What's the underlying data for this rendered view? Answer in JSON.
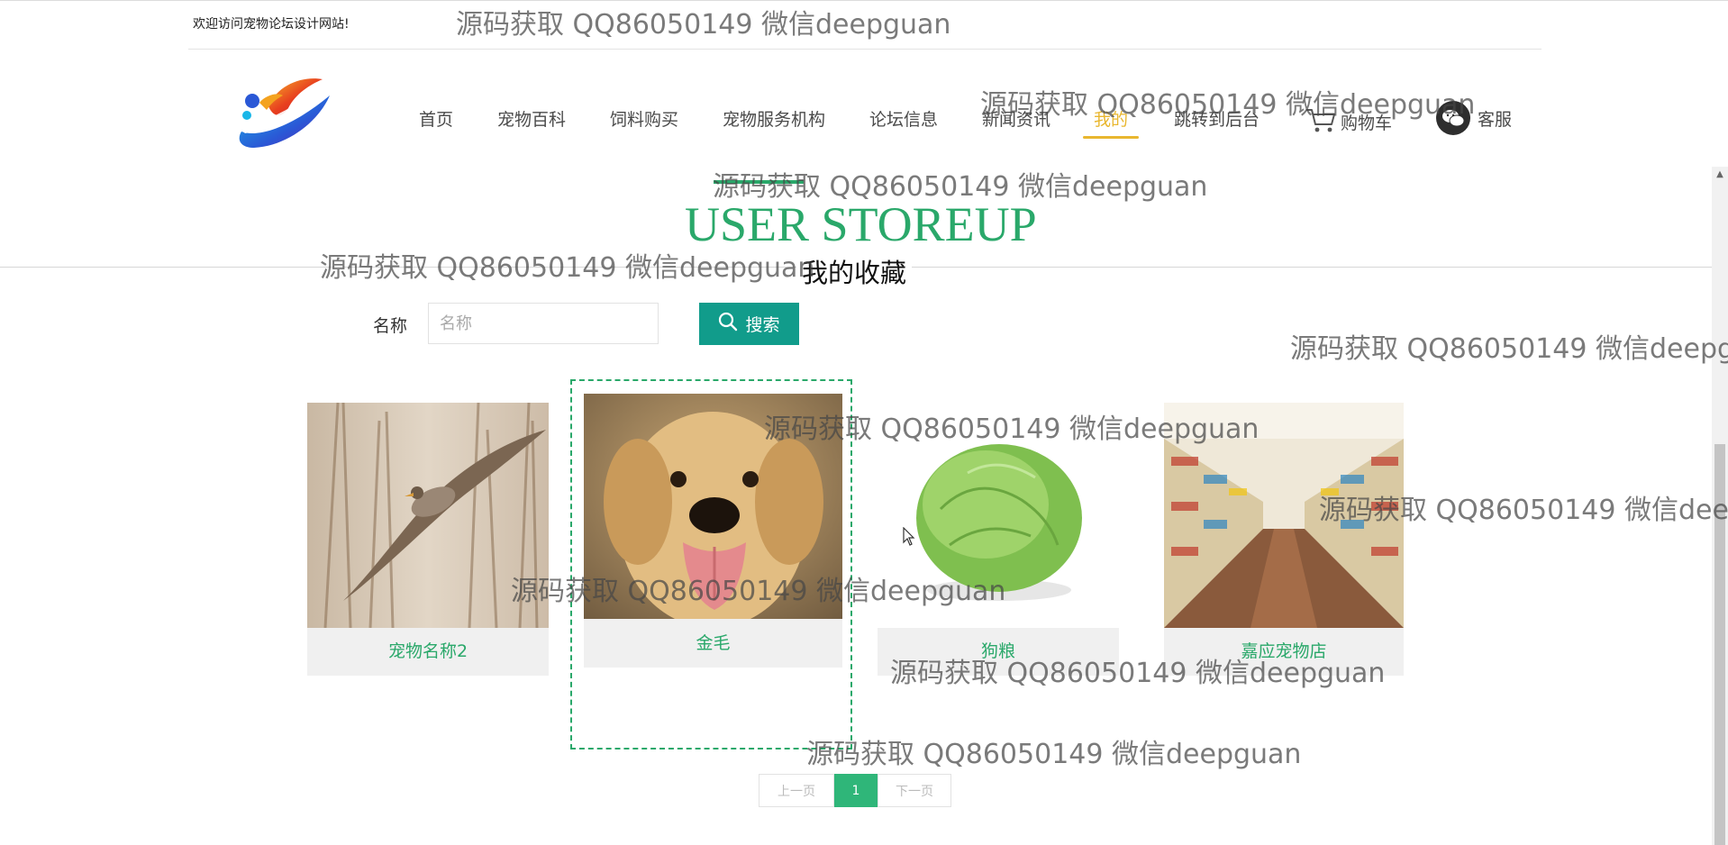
{
  "header": {
    "welcome": "欢迎访问宠物论坛设计网站!"
  },
  "nav": {
    "items": [
      {
        "label": "首页"
      },
      {
        "label": "宠物百科"
      },
      {
        "label": "饲料购买"
      },
      {
        "label": "宠物服务机构"
      },
      {
        "label": "论坛信息"
      },
      {
        "label": "新闻资讯"
      },
      {
        "label": "我的"
      },
      {
        "label": "跳转到后台"
      }
    ],
    "active": "我的",
    "cart_label": "购物车",
    "service_label": "客服"
  },
  "page": {
    "title_en": "USER STOREUP",
    "title_zh": "我的收藏"
  },
  "search": {
    "label": "名称",
    "placeholder": "名称",
    "value": "",
    "button_label": "搜索"
  },
  "cards": [
    {
      "name": "宠物名称2"
    },
    {
      "name": "金毛"
    },
    {
      "name": "狗粮"
    },
    {
      "name": "嘉应宠物店"
    }
  ],
  "pagination": {
    "prev_label": "上一页",
    "current": "1",
    "next_label": "下一页"
  },
  "watermark": {
    "text": "源码获取 QQ86050149 微信deepguan"
  },
  "colors": {
    "accent_green": "#2aa86a",
    "search_button": "#119c8b",
    "nav_active": "#e9b730",
    "page_current": "#2fb679"
  }
}
